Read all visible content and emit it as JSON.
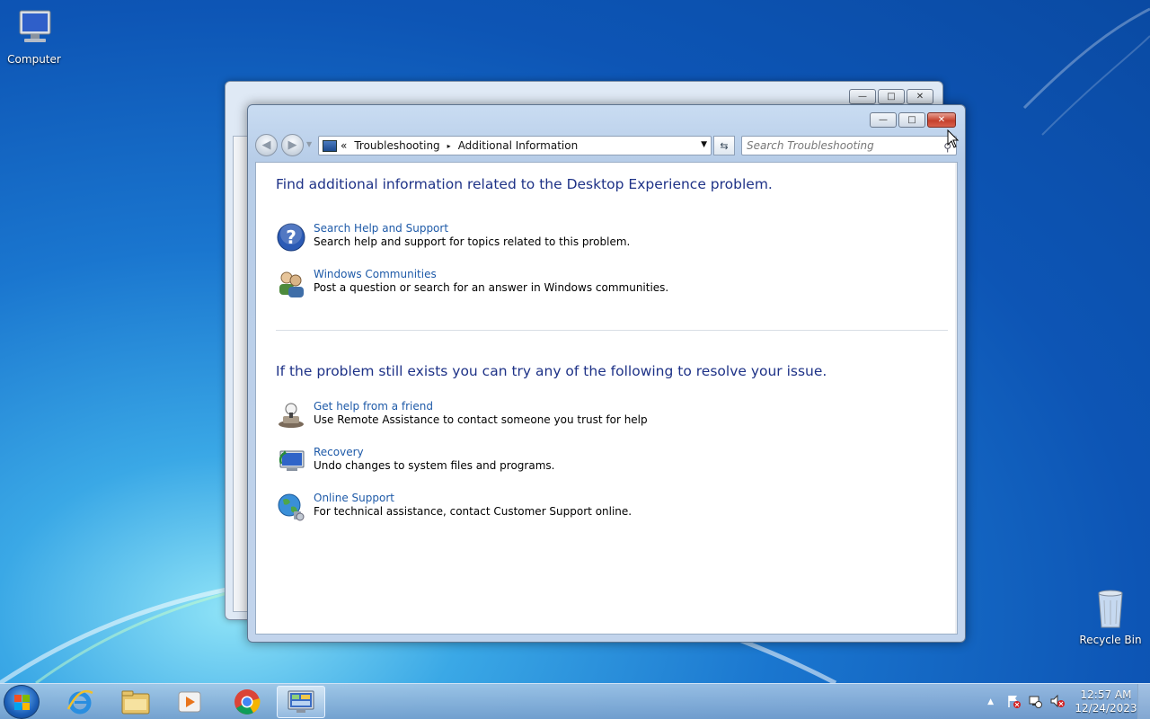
{
  "desktop": {
    "icons": [
      {
        "label": "Computer",
        "icon": "computer-icon"
      },
      {
        "label": "Recycle Bin",
        "icon": "recycle-bin-icon"
      }
    ]
  },
  "window": {
    "caption_buttons": {
      "minimize": "—",
      "maximize": "□",
      "close": "✕"
    },
    "nav": {
      "back": "◀",
      "forward": "▶"
    },
    "address": {
      "prefix": "«",
      "crumbs": [
        "Troubleshooting",
        "Additional Information"
      ],
      "separator": "▸"
    },
    "search_placeholder": "Search Troubleshooting",
    "section1": {
      "heading": "Find additional information related to the Desktop Experience problem.",
      "items": [
        {
          "icon": "help-icon",
          "link": "Search Help and Support",
          "desc": "Search help and support for topics related to this problem."
        },
        {
          "icon": "communities-icon",
          "link": "Windows Communities",
          "desc": "Post a question or search for an answer in Windows communities."
        }
      ]
    },
    "section2": {
      "heading": "If the problem still exists you can try any of the following to resolve your issue.",
      "items": [
        {
          "icon": "remote-assistance-icon",
          "link": "Get help from a friend",
          "desc": "Use Remote Assistance to contact someone you trust for help"
        },
        {
          "icon": "recovery-icon",
          "link": "Recovery",
          "desc": "Undo changes to system files and programs."
        },
        {
          "icon": "globe-icon",
          "link": "Online Support",
          "desc": "For technical assistance, contact Customer Support online."
        }
      ]
    }
  },
  "taskbar": {
    "apps": [
      "internet-explorer-icon",
      "file-explorer-icon",
      "media-player-icon",
      "chrome-icon",
      "control-panel-icon"
    ],
    "time": "12:57 AM",
    "date": "12/24/2023",
    "tray_icons": [
      "show-hidden-icons",
      "action-center-icon",
      "network-icon",
      "volume-muted-icon"
    ]
  }
}
